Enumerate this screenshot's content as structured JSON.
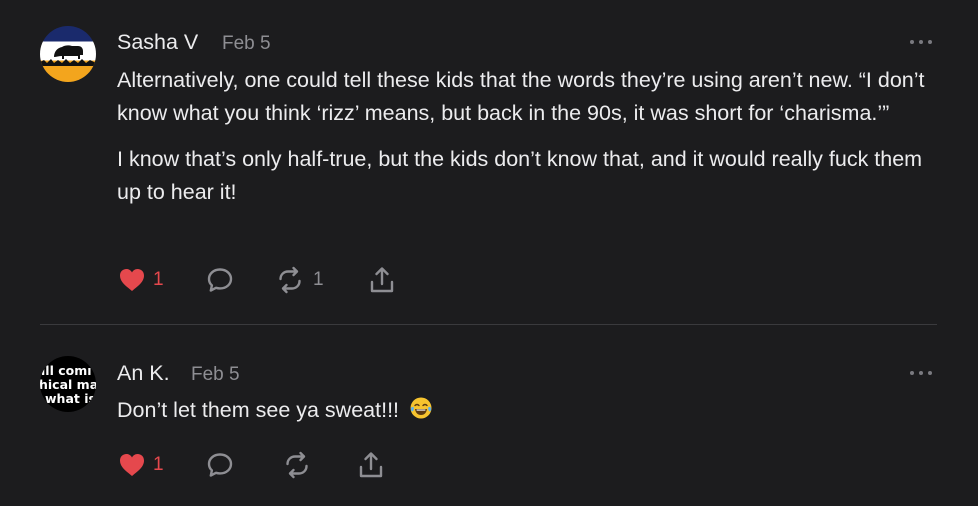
{
  "comments": [
    {
      "author": "Sasha V",
      "date": "Feb 5",
      "avatar_icon": "bison-flag-icon",
      "body_paragraphs": [
        "Alternatively, one could tell these kids that the words they’re using aren’t new. “I don’t know what you think ‘rizz’ means, but back in the 90s, it was short for ‘charisma.’”",
        "I know that’s only half-true, but the kids don’t know that, and it would really fuck them up to hear it!"
      ],
      "like_count": "1",
      "liked": true,
      "restack_count": "1",
      "icons": [
        "heart-icon",
        "comment-bubble-icon",
        "restack-icon",
        "share-icon",
        "more-options-icon"
      ]
    },
    {
      "author": "An K.",
      "date": "Feb 5",
      "avatar_text_lines": [
        "ıll comı",
        "hical ma",
        "what is"
      ],
      "body": "Don’t let them see ya sweat!!!",
      "body_emoji": "😂",
      "like_count": "1",
      "liked": true,
      "icons": [
        "heart-icon",
        "comment-bubble-icon",
        "restack-icon",
        "share-icon",
        "more-options-icon"
      ]
    }
  ],
  "colors": {
    "background": "#1c1c1e",
    "text": "#ececee",
    "muted": "#8e8e93",
    "like": "#e5484d",
    "divider": "#3a3a3d"
  }
}
